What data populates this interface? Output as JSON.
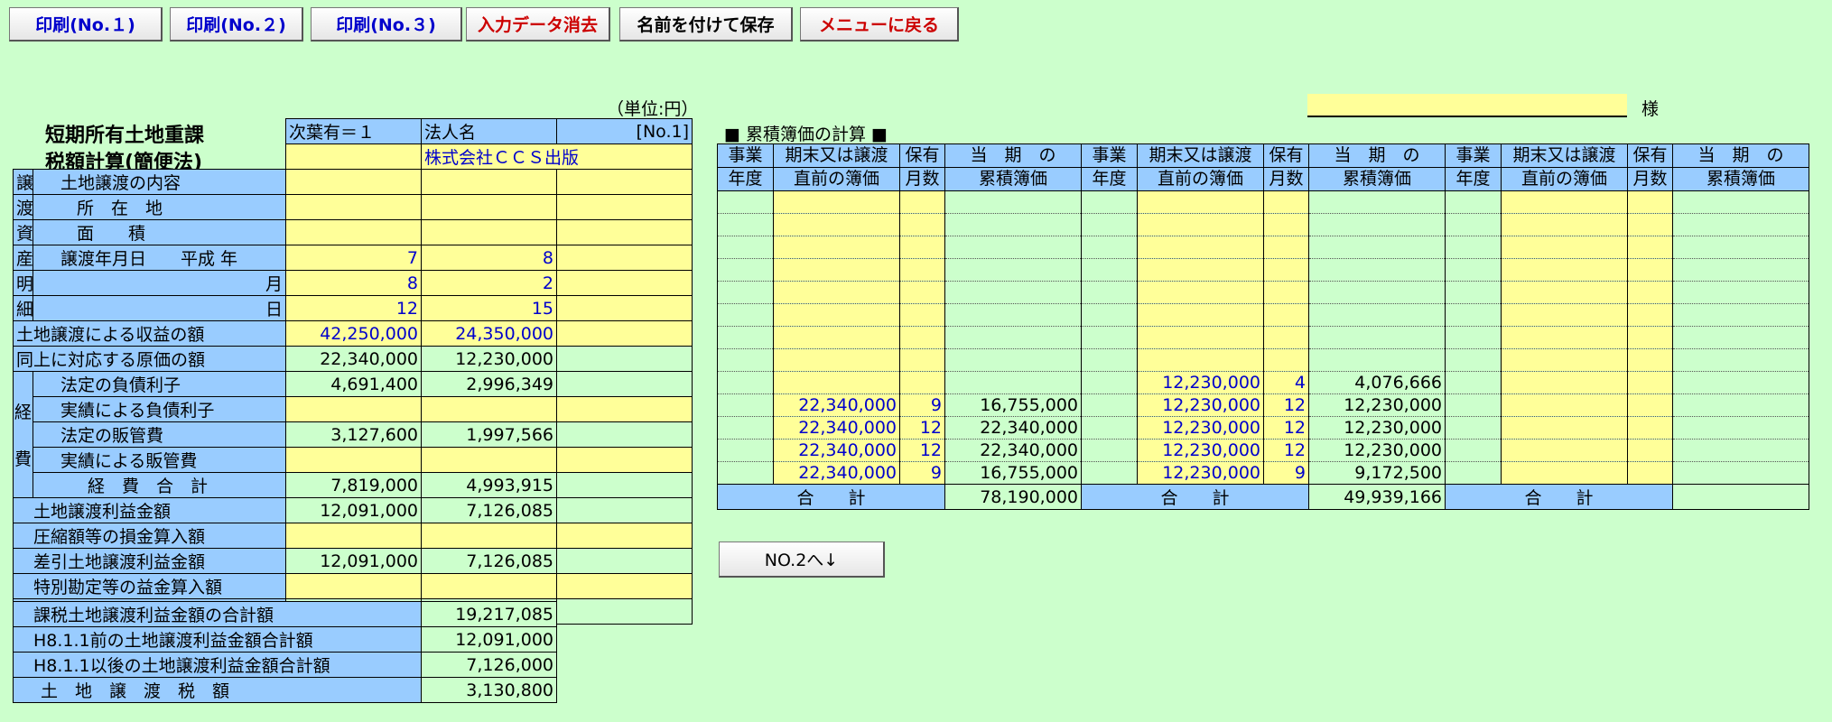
{
  "toolbar": {
    "print1": "印刷(No.１)",
    "print2": "印刷(No.２)",
    "print3": "印刷(No.３)",
    "clear": "入力データ消去",
    "save_as": "名前を付けて保存",
    "menu": "メニューに戻る"
  },
  "unit": "（単位:円）",
  "customer_suffix": "様",
  "customer_name": "",
  "title_line1": "短期所有土地重課",
  "title_line2": "税額計算(簡便法)",
  "header": {
    "next_page": "次葉有＝１",
    "corp_label": "法人名",
    "page_no": "[No.1]",
    "corp_name": "株式会社ＣＣＳ出版"
  },
  "side_labels": {
    "asset": [
      "譲",
      "渡",
      "資",
      "産",
      "明",
      "細"
    ],
    "expense": [
      "経",
      "費"
    ]
  },
  "rows": [
    {
      "label": "土地譲渡の内容",
      "v1": "",
      "v2": "",
      "v3": ""
    },
    {
      "label": "所　在　地",
      "v1": "",
      "v2": "",
      "v3": ""
    },
    {
      "label": "面　　積",
      "v1": "",
      "v2": "",
      "v3": ""
    },
    {
      "label": "譲渡年月日　　平成 年",
      "v1": "7",
      "v2": "8",
      "v3": ""
    },
    {
      "label": "月",
      "v1": "8",
      "v2": "2",
      "v3": ""
    },
    {
      "label": "日",
      "v1": "12",
      "v2": "15",
      "v3": ""
    },
    {
      "label": "土地譲渡による収益の額",
      "v1": "42,250,000",
      "v2": "24,350,000",
      "v3": ""
    },
    {
      "label": "同上に対応する原価の額",
      "v1": "22,340,000",
      "v2": "12,230,000",
      "v3": ""
    },
    {
      "label": "法定の負債利子",
      "v1": "4,691,400",
      "v2": "2,996,349",
      "v3": ""
    },
    {
      "label": "実績による負債利子",
      "v1": "",
      "v2": "",
      "v3": ""
    },
    {
      "label": "法定の販管費",
      "v1": "3,127,600",
      "v2": "1,997,566",
      "v3": ""
    },
    {
      "label": "実績による販管費",
      "v1": "",
      "v2": "",
      "v3": ""
    },
    {
      "label": "経　費　合　計",
      "v1": "7,819,000",
      "v2": "4,993,915",
      "v3": ""
    },
    {
      "label": "土地譲渡利益金額",
      "v1": "12,091,000",
      "v2": "7,126,085",
      "v3": ""
    },
    {
      "label": "圧縮額等の損金算入額",
      "v1": "",
      "v2": "",
      "v3": ""
    },
    {
      "label": "差引土地譲渡利益金額",
      "v1": "12,091,000",
      "v2": "7,126,085",
      "v3": ""
    },
    {
      "label": "特別勘定等の益金算入額",
      "v1": "",
      "v2": "",
      "v3": ""
    },
    {
      "label": "課税土地譲渡利益金額",
      "v1": "12,091,000",
      "v2": "7,126,085",
      "v3": ""
    }
  ],
  "totals": [
    {
      "label": "課税土地譲渡利益金額の合計額",
      "value": "19,217,085"
    },
    {
      "label": "H8.1.1前の土地譲渡利益金額合計額",
      "value": "12,091,000"
    },
    {
      "label": "H8.1.1以後の土地譲渡利益金額合計額",
      "value": "7,126,000"
    },
    {
      "label": "土　地　譲　渡　税　額",
      "value": "3,130,800"
    }
  ],
  "accum": {
    "title": "■ 累積簿価の計算 ■",
    "col_h1": [
      "事業",
      "期末又は譲渡",
      "保有",
      "当　期　の"
    ],
    "col_h2": [
      "年度",
      "直前の簿価",
      "月数",
      "累積簿価"
    ],
    "groups": [
      {
        "rows": [
          [
            "",
            "",
            "",
            ""
          ],
          [
            "",
            "",
            "",
            ""
          ],
          [
            "",
            "",
            "",
            ""
          ],
          [
            "",
            "",
            "",
            ""
          ],
          [
            "",
            "",
            "",
            ""
          ],
          [
            "",
            "",
            "",
            ""
          ],
          [
            "",
            "",
            "",
            ""
          ],
          [
            "",
            "",
            "",
            ""
          ],
          [
            "",
            "",
            "",
            ""
          ],
          [
            "",
            "22,340,000",
            "9",
            "16,755,000"
          ],
          [
            "",
            "22,340,000",
            "12",
            "22,340,000"
          ],
          [
            "",
            "22,340,000",
            "12",
            "22,340,000"
          ],
          [
            "",
            "22,340,000",
            "9",
            "16,755,000"
          ]
        ],
        "total_label": "合　　計",
        "total": "78,190,000"
      },
      {
        "rows": [
          [
            "",
            "",
            "",
            ""
          ],
          [
            "",
            "",
            "",
            ""
          ],
          [
            "",
            "",
            "",
            ""
          ],
          [
            "",
            "",
            "",
            ""
          ],
          [
            "",
            "",
            "",
            ""
          ],
          [
            "",
            "",
            "",
            ""
          ],
          [
            "",
            "",
            "",
            ""
          ],
          [
            "",
            "",
            "",
            ""
          ],
          [
            "",
            "12,230,000",
            "4",
            "4,076,666"
          ],
          [
            "",
            "12,230,000",
            "12",
            "12,230,000"
          ],
          [
            "",
            "12,230,000",
            "12",
            "12,230,000"
          ],
          [
            "",
            "12,230,000",
            "12",
            "12,230,000"
          ],
          [
            "",
            "12,230,000",
            "9",
            "9,172,500"
          ]
        ],
        "total_label": "合　　計",
        "total": "49,939,166"
      },
      {
        "rows": [
          [
            "",
            "",
            "",
            ""
          ],
          [
            "",
            "",
            "",
            ""
          ],
          [
            "",
            "",
            "",
            ""
          ],
          [
            "",
            "",
            "",
            ""
          ],
          [
            "",
            "",
            "",
            ""
          ],
          [
            "",
            "",
            "",
            ""
          ],
          [
            "",
            "",
            "",
            ""
          ],
          [
            "",
            "",
            "",
            ""
          ],
          [
            "",
            "",
            "",
            ""
          ],
          [
            "",
            "",
            "",
            ""
          ],
          [
            "",
            "",
            "",
            ""
          ],
          [
            "",
            "",
            "",
            ""
          ],
          [
            "",
            "",
            "",
            ""
          ]
        ],
        "total_label": "合　　計",
        "total": ""
      }
    ]
  },
  "next_button": "NO.2へ↓"
}
